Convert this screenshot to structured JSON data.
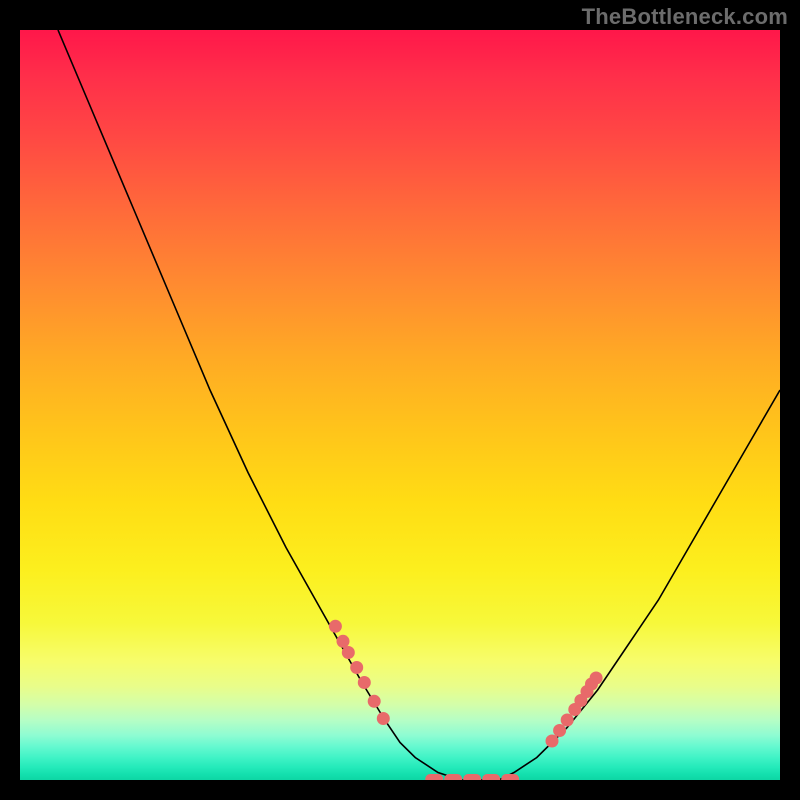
{
  "watermark": "TheBottleneck.com",
  "chart_data": {
    "type": "line",
    "title": "",
    "xlabel": "",
    "ylabel": "",
    "xlim": [
      0,
      100
    ],
    "ylim": [
      0,
      100
    ],
    "curve": {
      "name": "bottleneck-curve",
      "x": [
        5,
        10,
        15,
        20,
        25,
        30,
        35,
        40,
        45,
        48,
        50,
        52,
        55,
        58,
        60,
        63,
        65,
        68,
        72,
        76,
        80,
        84,
        88,
        92,
        96,
        100
      ],
      "y": [
        100,
        88,
        76,
        64,
        52,
        41,
        31,
        22,
        13,
        8,
        5,
        3,
        1,
        0,
        0,
        0,
        1,
        3,
        7,
        12,
        18,
        24,
        31,
        38,
        45,
        52
      ]
    },
    "markers_left": {
      "name": "left-highlight-dots",
      "x": [
        41.5,
        42.5,
        43.2,
        44.3,
        45.3,
        46.6,
        47.8
      ],
      "y": [
        20.5,
        18.5,
        17.0,
        15.0,
        13.0,
        10.5,
        8.2
      ]
    },
    "markers_right": {
      "name": "right-highlight-dots",
      "x": [
        70.0,
        71.0,
        72.0,
        73.0,
        73.8,
        74.6,
        75.2,
        75.8
      ],
      "y": [
        5.2,
        6.6,
        8.0,
        9.4,
        10.6,
        11.8,
        12.8,
        13.6
      ]
    },
    "bottom_dashes": {
      "name": "bottom-highlight-dashes",
      "x": [
        54.5,
        57.0,
        59.5,
        62.0,
        64.5
      ],
      "y": [
        0,
        0,
        0,
        0,
        0
      ]
    },
    "colors": {
      "curve": "#000000",
      "marker": "#e86a6a",
      "gradient_top": "#ff174a",
      "gradient_mid": "#ffdd14",
      "gradient_bottom": "#0ed6a4",
      "background": "#000000"
    }
  }
}
